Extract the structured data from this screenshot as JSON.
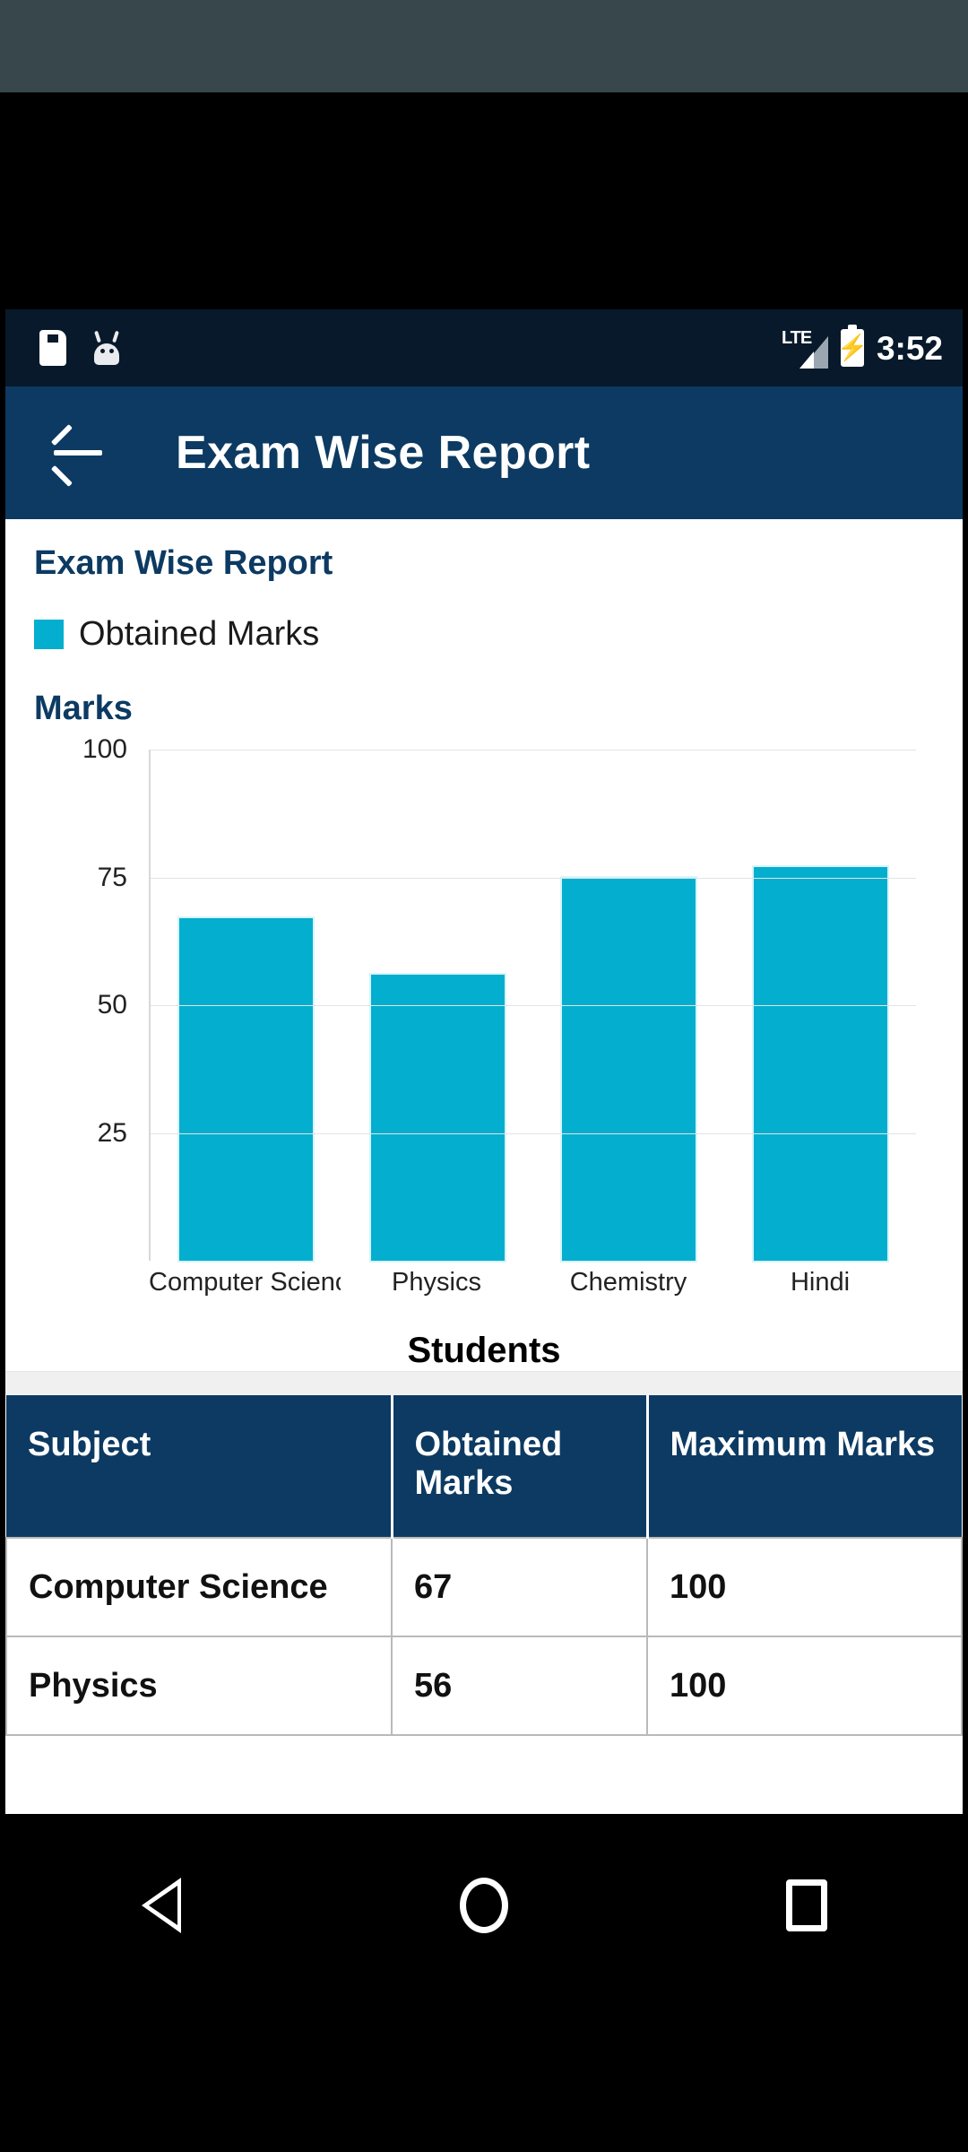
{
  "status_bar": {
    "time": "3:52",
    "network": "LTE",
    "icons": [
      "sim-card-icon",
      "android-head-icon",
      "lte-signal-icon",
      "battery-charging-icon"
    ]
  },
  "app_bar": {
    "back_label": "back-arrow",
    "title": "Exam Wise Report"
  },
  "chart_card": {
    "title": "Exam Wise Report",
    "legend_label": "Obtained Marks",
    "legend_color": "#03aece",
    "y_axis_title": "Marks",
    "x_axis_title": "Students"
  },
  "chart_data": {
    "type": "bar",
    "title": "Exam Wise Report",
    "categories": [
      "Computer Science",
      "Physics",
      "Chemistry",
      "Hindi"
    ],
    "series": [
      {
        "name": "Obtained Marks",
        "values": [
          67,
          56,
          75,
          77
        ],
        "color": "#03aece"
      }
    ],
    "values": [
      67,
      56,
      75,
      77
    ],
    "xlabel": "Students",
    "ylabel": "Marks",
    "ylim": [
      0,
      100
    ],
    "yticks": [
      100,
      75,
      50,
      25
    ],
    "grid": true,
    "legend_position": "top-left",
    "legend": [
      "Obtained Marks"
    ]
  },
  "table": {
    "headers": [
      "Subject",
      "Obtained Marks",
      "Maximum Marks"
    ],
    "rows": [
      {
        "subject": "Computer Science",
        "obtained": "67",
        "maximum": "100"
      },
      {
        "subject": "Physics",
        "obtained": "56",
        "maximum": "100"
      }
    ]
  },
  "nav_bar": {
    "back": "back-triangle-icon",
    "home": "home-circle-icon",
    "recents": "recents-square-icon"
  },
  "colors": {
    "app_bar": "#0c3a62",
    "status_bar": "#07192a",
    "accent": "#03aece",
    "top_band": "#38474c"
  }
}
